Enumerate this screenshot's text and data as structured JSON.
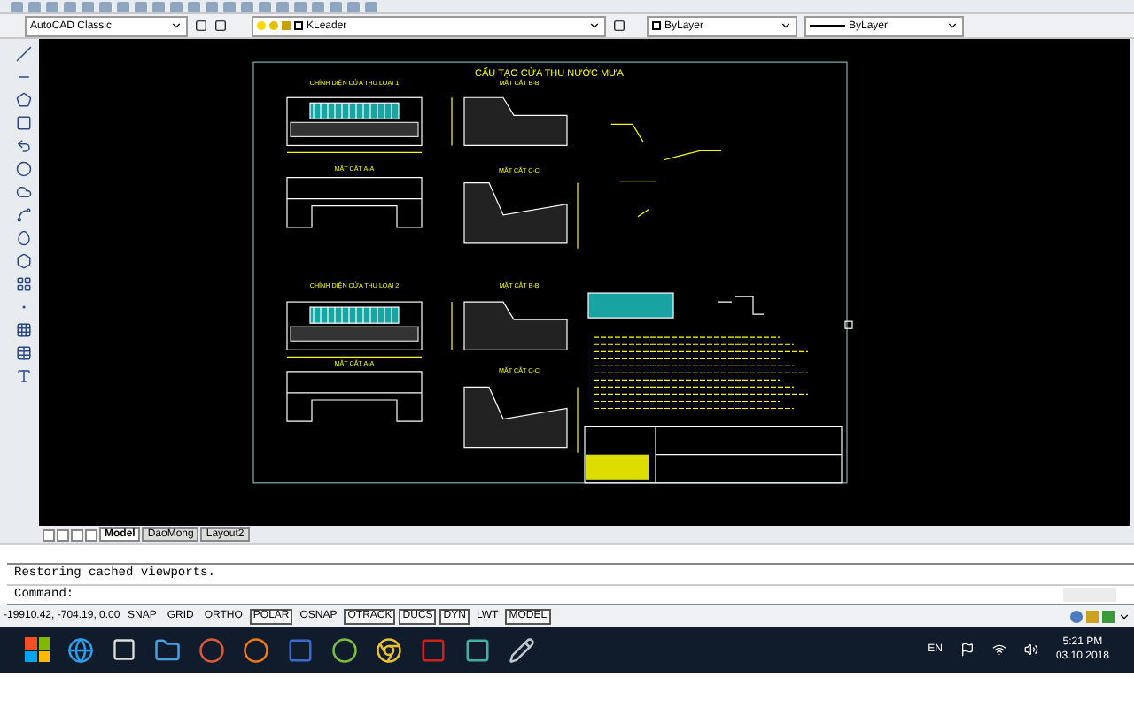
{
  "toolbar": {
    "workspace": "AutoCAD Classic",
    "layer": "KLeader",
    "color_setting": "ByLayer",
    "linetype": "ByLayer"
  },
  "drawing": {
    "title": "CẤU TẠO CỬA THU NƯỚC MƯA",
    "labels": [
      "CHÍNH DIỆN CỬA THU LOẠI 1",
      "MẶT CẮT B-B",
      "MẶT CẮT A-A",
      "MẶT CẮT C-C",
      "CHÍNH DIỆN CỬA THU LOẠI 2",
      "MẶT CẮT B-B",
      "MẶT CẮT A-A",
      "MẶT CẮT C-C"
    ]
  },
  "layout_tabs": [
    {
      "label": "Model",
      "selected": true
    },
    {
      "label": "DaoMong",
      "selected": false
    },
    {
      "label": "Layout2",
      "selected": false
    }
  ],
  "command_history": [
    "Restoring cached viewports."
  ],
  "command_prompt": "Command:",
  "status_bar": {
    "coordinates": "-19910.42, -704.19, 0.00",
    "toggles": [
      {
        "label": "SNAP",
        "on": false
      },
      {
        "label": "GRID",
        "on": false
      },
      {
        "label": "ORTHO",
        "on": false
      },
      {
        "label": "POLAR",
        "on": true
      },
      {
        "label": "OSNAP",
        "on": false
      },
      {
        "label": "OTRACK",
        "on": true
      },
      {
        "label": "DUCS",
        "on": true
      },
      {
        "label": "DYN",
        "on": true
      },
      {
        "label": "LWT",
        "on": false
      },
      {
        "label": "MODEL",
        "on": true
      }
    ]
  },
  "taskbar": {
    "language": "EN",
    "time": "5:21 PM",
    "date": "03.10.2018"
  }
}
